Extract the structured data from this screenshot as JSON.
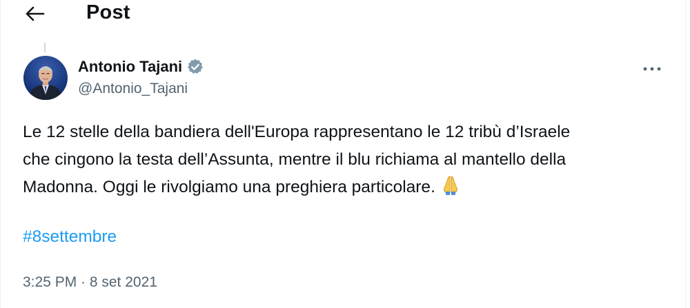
{
  "header": {
    "title": "Post",
    "back_icon": "arrow-left-icon"
  },
  "author": {
    "name": "Antonio Tajani",
    "handle": "@Antonio_Tajani",
    "verified_icon": "verified-badge-icon",
    "verified_color": "#829aab"
  },
  "tweet": {
    "lines": [
      "Le 12 stelle della bandiera dell'Europa rappresentano le 12 tribù d’Israele",
      "che cingono la testa dell’Assunta, mentre il blu richiama al mantello della",
      "Madonna. Oggi le rivolgiamo una preghiera particolare."
    ],
    "emoji": "🙏",
    "hashtag": "#8settembre",
    "timestamp": "3:25 PM · 8 set 2021"
  },
  "more_icon": "more-horizontal-icon",
  "colors": {
    "text": "#0f1419",
    "secondary": "#536471",
    "link": "#1d9bf0"
  }
}
